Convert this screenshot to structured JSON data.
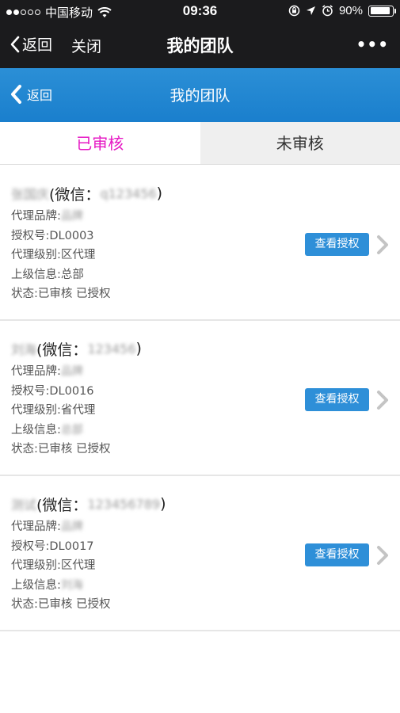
{
  "status_bar": {
    "carrier": "中国移动",
    "time": "09:36",
    "battery": "90%",
    "battery_level": 0.9
  },
  "wechat_nav": {
    "back_label": "返回",
    "close_label": "关闭",
    "title": "我的团队",
    "more_label": "•••"
  },
  "page_header": {
    "back_label": "返回",
    "title": "我的团队"
  },
  "tabs": [
    {
      "label": "已审核",
      "active": true
    },
    {
      "label": "未审核",
      "active": false
    }
  ],
  "members": [
    {
      "name": "张国庆",
      "wechat_prefix": "(微信：",
      "wechat_id": "q123456",
      "wechat_suffix": ")",
      "brand_label": "代理品牌:",
      "brand_value": "品牌",
      "auth_label": "授权号:",
      "auth_value": "DL0003",
      "level_label": "代理级别:",
      "level_value": "区代理",
      "parent_label": "上级信息:",
      "parent_value": "总部",
      "status": "状态:已审核 已授权",
      "button": "查看授权"
    },
    {
      "name": "刘海",
      "wechat_prefix": "(微信：",
      "wechat_id": "123456",
      "wechat_suffix": ")",
      "brand_label": "代理品牌:",
      "brand_value": "品牌",
      "auth_label": "授权号:",
      "auth_value": "DL0016",
      "level_label": "代理级别:",
      "level_value": "省代理",
      "parent_label": "上级信息:",
      "parent_value": "总部",
      "status": "状态:已审核 已授权",
      "button": "查看授权"
    },
    {
      "name": "测试",
      "wechat_prefix": "(微信：",
      "wechat_id": "123456789",
      "wechat_suffix": ")",
      "brand_label": "代理品牌:",
      "brand_value": "品牌",
      "auth_label": "授权号:",
      "auth_value": "DL0017",
      "level_label": "代理级别:",
      "level_value": "区代理",
      "parent_label": "上级信息:",
      "parent_value": "刘海",
      "status": "状态:已审核 已授权",
      "button": "查看授权"
    }
  ],
  "colors": {
    "header_blue": "#1a7fcd",
    "active_tab": "#e619c4",
    "button_blue": "#2e8fd8",
    "nav_dark": "#1b1b1d"
  }
}
